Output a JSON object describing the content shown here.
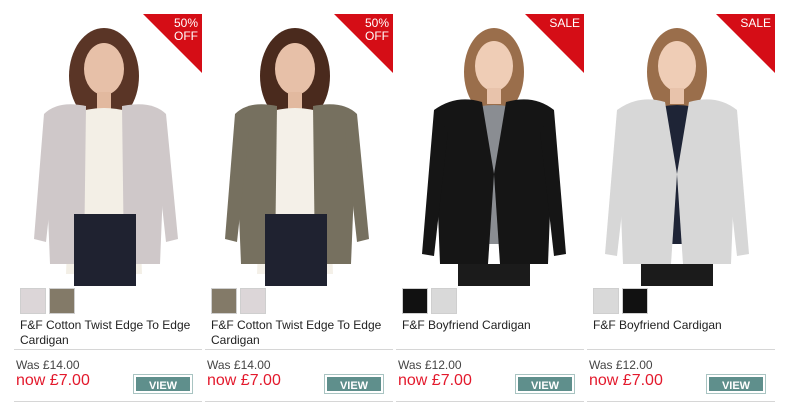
{
  "products": [
    {
      "badge": "50%\nOFF",
      "cardigan_color": "#cfc8c9",
      "top_color": "#f3efe6",
      "swatches": [
        {
          "name": "oatmeal-swatch",
          "color": "#dcd6d8"
        },
        {
          "name": "khaki-swatch",
          "color": "#837a68"
        }
      ],
      "name": "F&F Cotton Twist Edge To Edge Cardigan",
      "was": "Was £14.00",
      "now": "now £7.00",
      "view": "VIEW"
    },
    {
      "badge": "50%\nOFF",
      "cardigan_color": "#76705f",
      "top_color": "#f4f0e8",
      "swatches": [
        {
          "name": "khaki-swatch",
          "color": "#837a68"
        },
        {
          "name": "oatmeal-swatch",
          "color": "#dcd6d8"
        }
      ],
      "name": "F&F Cotton Twist Edge To Edge Cardigan",
      "was": "Was £14.00",
      "now": "now £7.00",
      "view": "VIEW"
    },
    {
      "badge": "SALE",
      "cardigan_color": "#151515",
      "top_color": "#8a8d92",
      "swatches": [
        {
          "name": "black-swatch",
          "color": "#111111"
        },
        {
          "name": "grey-swatch",
          "color": "#d9d9d9"
        }
      ],
      "name": "F&F Boyfriend Cardigan",
      "was": "Was £12.00",
      "now": "now £7.00",
      "view": "VIEW"
    },
    {
      "badge": "SALE",
      "cardigan_color": "#d7d7d7",
      "top_color": "#1e2436",
      "swatches": [
        {
          "name": "grey-swatch",
          "color": "#d9d9d9"
        },
        {
          "name": "black-swatch",
          "color": "#111111"
        }
      ],
      "name": "F&F Boyfriend Cardigan",
      "was": "Was £12.00",
      "now": "now £7.00",
      "view": "VIEW"
    }
  ],
  "colors": {
    "badge_red": "#d50d16",
    "price_red": "#e3192c",
    "view_button": "#5f8f8c"
  }
}
